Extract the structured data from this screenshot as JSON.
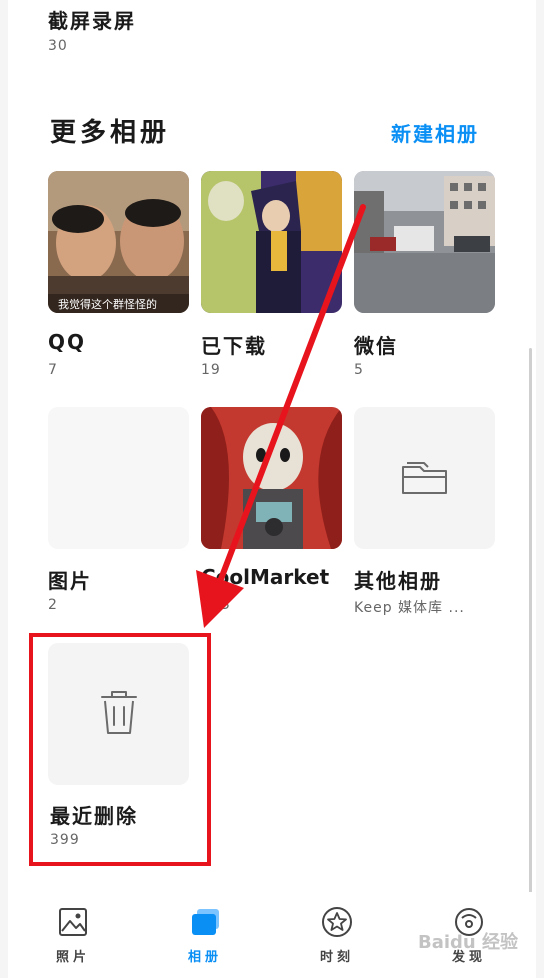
{
  "top_album": {
    "title": "截屏录屏",
    "count": "30"
  },
  "more_albums": {
    "title": "更多相册",
    "new_album_label": "新建相册"
  },
  "albums": [
    {
      "title": "QQ",
      "count": "7",
      "caption": "我觉得这个群怪怪的"
    },
    {
      "title": "已下载",
      "count": "19"
    },
    {
      "title": "微信",
      "count": "5"
    },
    {
      "title": "图片",
      "count": "2"
    },
    {
      "title": "CoolMarket",
      "count": "103"
    },
    {
      "title": "其他相册",
      "count": "Keep 媒体库 ..."
    },
    {
      "title": "最近删除",
      "count": "399"
    }
  ],
  "nav": {
    "items": [
      {
        "label": "照片",
        "icon": "photo-icon"
      },
      {
        "label": "相册",
        "icon": "album-icon",
        "active": true
      },
      {
        "label": "时刻",
        "icon": "star-icon"
      },
      {
        "label": "发现",
        "icon": "discover-icon"
      }
    ],
    "active_color": "#0a8ff5"
  },
  "watermark": "Baidu 经验",
  "colors": {
    "accent": "#0a8ff5",
    "annotation": "#e8141d"
  }
}
